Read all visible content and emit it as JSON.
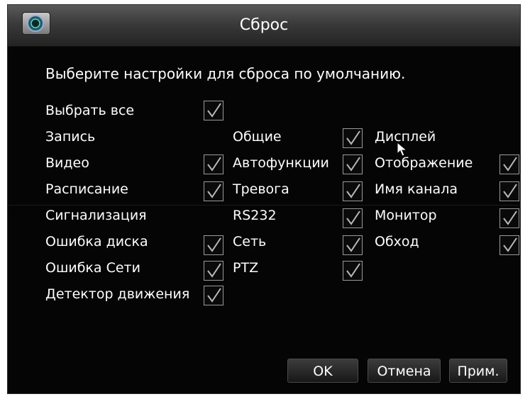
{
  "window": {
    "title": "Сброс",
    "logo_icon": "camera-lens-icon"
  },
  "heading": "Выберите настройки для сброса по умолчанию.",
  "select_all": {
    "label": "Выбрать все",
    "checked": true
  },
  "groups": {
    "record": {
      "label": "Запись",
      "items": [
        {
          "label": "Видео",
          "checked": true
        },
        {
          "label": "Расписание",
          "checked": true
        }
      ]
    },
    "alarm": {
      "label": "Сигнализация",
      "items": [
        {
          "label": "Ошибка диска",
          "checked": true
        },
        {
          "label": "Ошибка Сети",
          "checked": true
        },
        {
          "label": "Детектор движения",
          "checked": true
        }
      ]
    },
    "general": {
      "items": [
        {
          "label": "Общие",
          "checked": true
        },
        {
          "label": "Автофункции",
          "checked": true
        },
        {
          "label": "Тревога",
          "checked": true
        },
        {
          "label": "RS232",
          "checked": true
        },
        {
          "label": "Сеть",
          "checked": true
        },
        {
          "label": "PTZ",
          "checked": true
        }
      ]
    },
    "display": {
      "label": "Дисплей",
      "items": [
        {
          "label": "Отображение",
          "checked": true
        },
        {
          "label": "Имя канала",
          "checked": true
        },
        {
          "label": "Монитор",
          "checked": true
        },
        {
          "label": "Обход",
          "checked": true
        }
      ]
    }
  },
  "buttons": {
    "ok": "OK",
    "cancel": "Отмена",
    "apply": "Прим."
  },
  "colors": {
    "background": "#050505",
    "text": "#ffffff",
    "checkbox_border": "#9a9a9a"
  }
}
